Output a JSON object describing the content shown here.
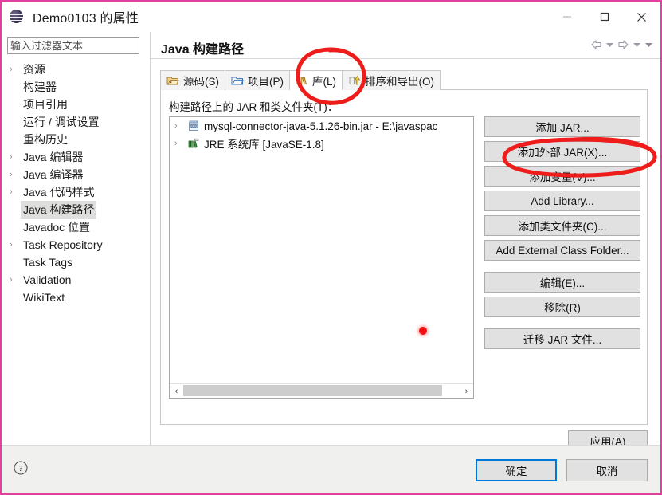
{
  "window": {
    "title": "Demo0103 的属性",
    "icon": "eclipse-properties-icon",
    "minimize_label": "最小化",
    "maximize_label": "最大化",
    "close_label": "关闭"
  },
  "sidebar": {
    "filter": {
      "placeholder": "输入过滤器文本",
      "value": ""
    },
    "items": [
      {
        "label": "资源",
        "expandable": true,
        "selected": false
      },
      {
        "label": "构建器",
        "expandable": false,
        "selected": false
      },
      {
        "label": "项目引用",
        "expandable": false,
        "selected": false
      },
      {
        "label": "运行 / 调试设置",
        "expandable": false,
        "selected": false
      },
      {
        "label": "重构历史",
        "expandable": false,
        "selected": false
      },
      {
        "label": "Java 编辑器",
        "expandable": true,
        "selected": false
      },
      {
        "label": "Java 编译器",
        "expandable": true,
        "selected": false
      },
      {
        "label": "Java 代码样式",
        "expandable": true,
        "selected": false
      },
      {
        "label": "Java 构建路径",
        "expandable": false,
        "selected": true
      },
      {
        "label": "Javadoc 位置",
        "expandable": false,
        "selected": false
      },
      {
        "label": "Task Repository",
        "expandable": true,
        "selected": false
      },
      {
        "label": "Task Tags",
        "expandable": false,
        "selected": false
      },
      {
        "label": "Validation",
        "expandable": true,
        "selected": false
      },
      {
        "label": "WikiText",
        "expandable": false,
        "selected": false
      }
    ]
  },
  "content": {
    "page_title": "Java 构建路径",
    "nav": {
      "back_label": "后退",
      "back_menu_label": "后退历史",
      "forward_label": "前进",
      "forward_menu_label": "前进历史",
      "menu_label": "视图菜单"
    },
    "tabs": [
      {
        "label": "源码(S)",
        "icon": "source-folder-icon",
        "active": false
      },
      {
        "label": "项目(P)",
        "icon": "project-folder-icon",
        "active": false
      },
      {
        "label": "库(L)",
        "icon": "library-icon",
        "active": true
      },
      {
        "label": "排序和导出(O)",
        "icon": "order-export-icon",
        "active": false
      }
    ],
    "list_caption": "构建路径上的 JAR 和类文件夹(T)：",
    "list_items": [
      {
        "label": "mysql-connector-java-5.1.26-bin.jar - E:\\javaspac",
        "icon": "jar-icon",
        "expandable": true
      },
      {
        "label": "JRE 系统库 [JavaSE-1.8]",
        "icon": "jre-library-icon",
        "expandable": true
      }
    ],
    "scrollbar": {
      "left_arrow": "‹",
      "right_arrow": "›"
    },
    "buttons": [
      {
        "label": "添加 JAR...",
        "group": 1
      },
      {
        "label": "添加外部 JAR(X)...",
        "group": 1
      },
      {
        "label": "添加变量(V)...",
        "group": 1
      },
      {
        "label": "Add Library...",
        "group": 1
      },
      {
        "label": "添加类文件夹(C)...",
        "group": 1
      },
      {
        "label": "Add External Class Folder...",
        "group": 1
      },
      {
        "label": "编辑(E)...",
        "group": 2
      },
      {
        "label": "移除(R)",
        "group": 2
      },
      {
        "label": "迁移 JAR 文件...",
        "group": 3
      }
    ],
    "apply_label": "应用(A)"
  },
  "footer": {
    "help_label": "帮助",
    "ok_label": "确定",
    "cancel_label": "取消"
  },
  "annotations": {
    "circle_tab_library": "红圈标注：库(L) 选项卡",
    "circle_add_external_jar": "红圈标注：添加外部 JAR(X)... 按钮",
    "red_dot": "红点标记",
    "color": "#f01010"
  }
}
